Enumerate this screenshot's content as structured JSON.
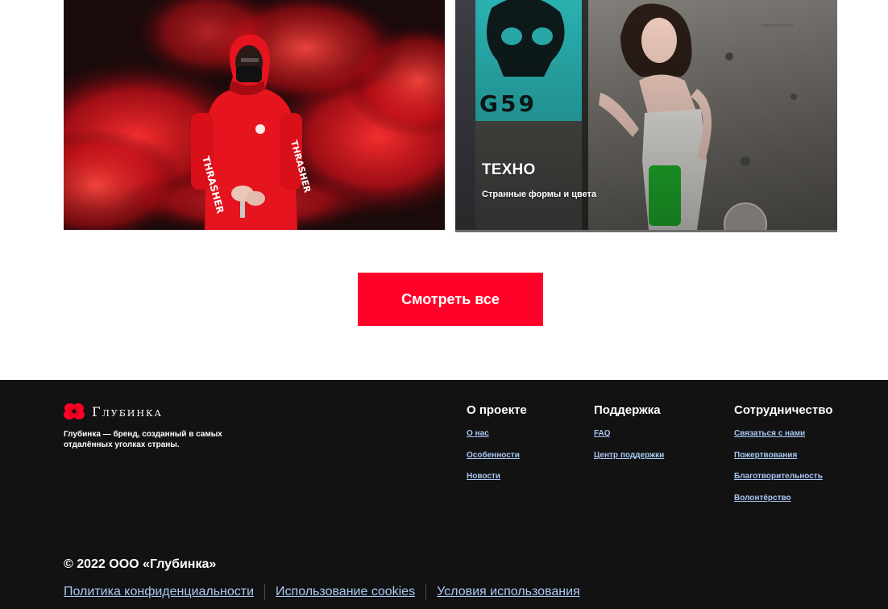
{
  "cards": [
    {
      "image_icon": "red-smoke-hoodie-photo",
      "title": "",
      "subtitle": ""
    },
    {
      "image_icon": "graffiti-wall-girl-photo",
      "title": "ТЕХНО",
      "subtitle": "Странные формы и цвета"
    }
  ],
  "view_all_label": "Смотреть все",
  "footer": {
    "brand_name": "Глубинка",
    "brand_logo_icon": "red-poppy-icon",
    "brand_description": "Глубинка — бренд, созданный в самых отдалённых уголках страны.",
    "columns": [
      {
        "title": "О проекте",
        "links": [
          "О нас",
          "Особенности",
          "Новости"
        ]
      },
      {
        "title": "Поддержка",
        "links": [
          "FAQ",
          "Центр поддержки"
        ]
      },
      {
        "title": "Сотрудничество",
        "links": [
          "Связаться с нами",
          "Пожертвования",
          "Благотворительность",
          "Волонтёрство"
        ]
      }
    ],
    "copyright": "© 2022 ООО «Глубинка»",
    "legal_links": [
      "Политика конфиденциальности",
      "Использование cookies",
      "Условия использования"
    ]
  },
  "colors": {
    "accent": "#ff0028",
    "footer_bg": "#121212",
    "link": "#a9c8f5"
  }
}
